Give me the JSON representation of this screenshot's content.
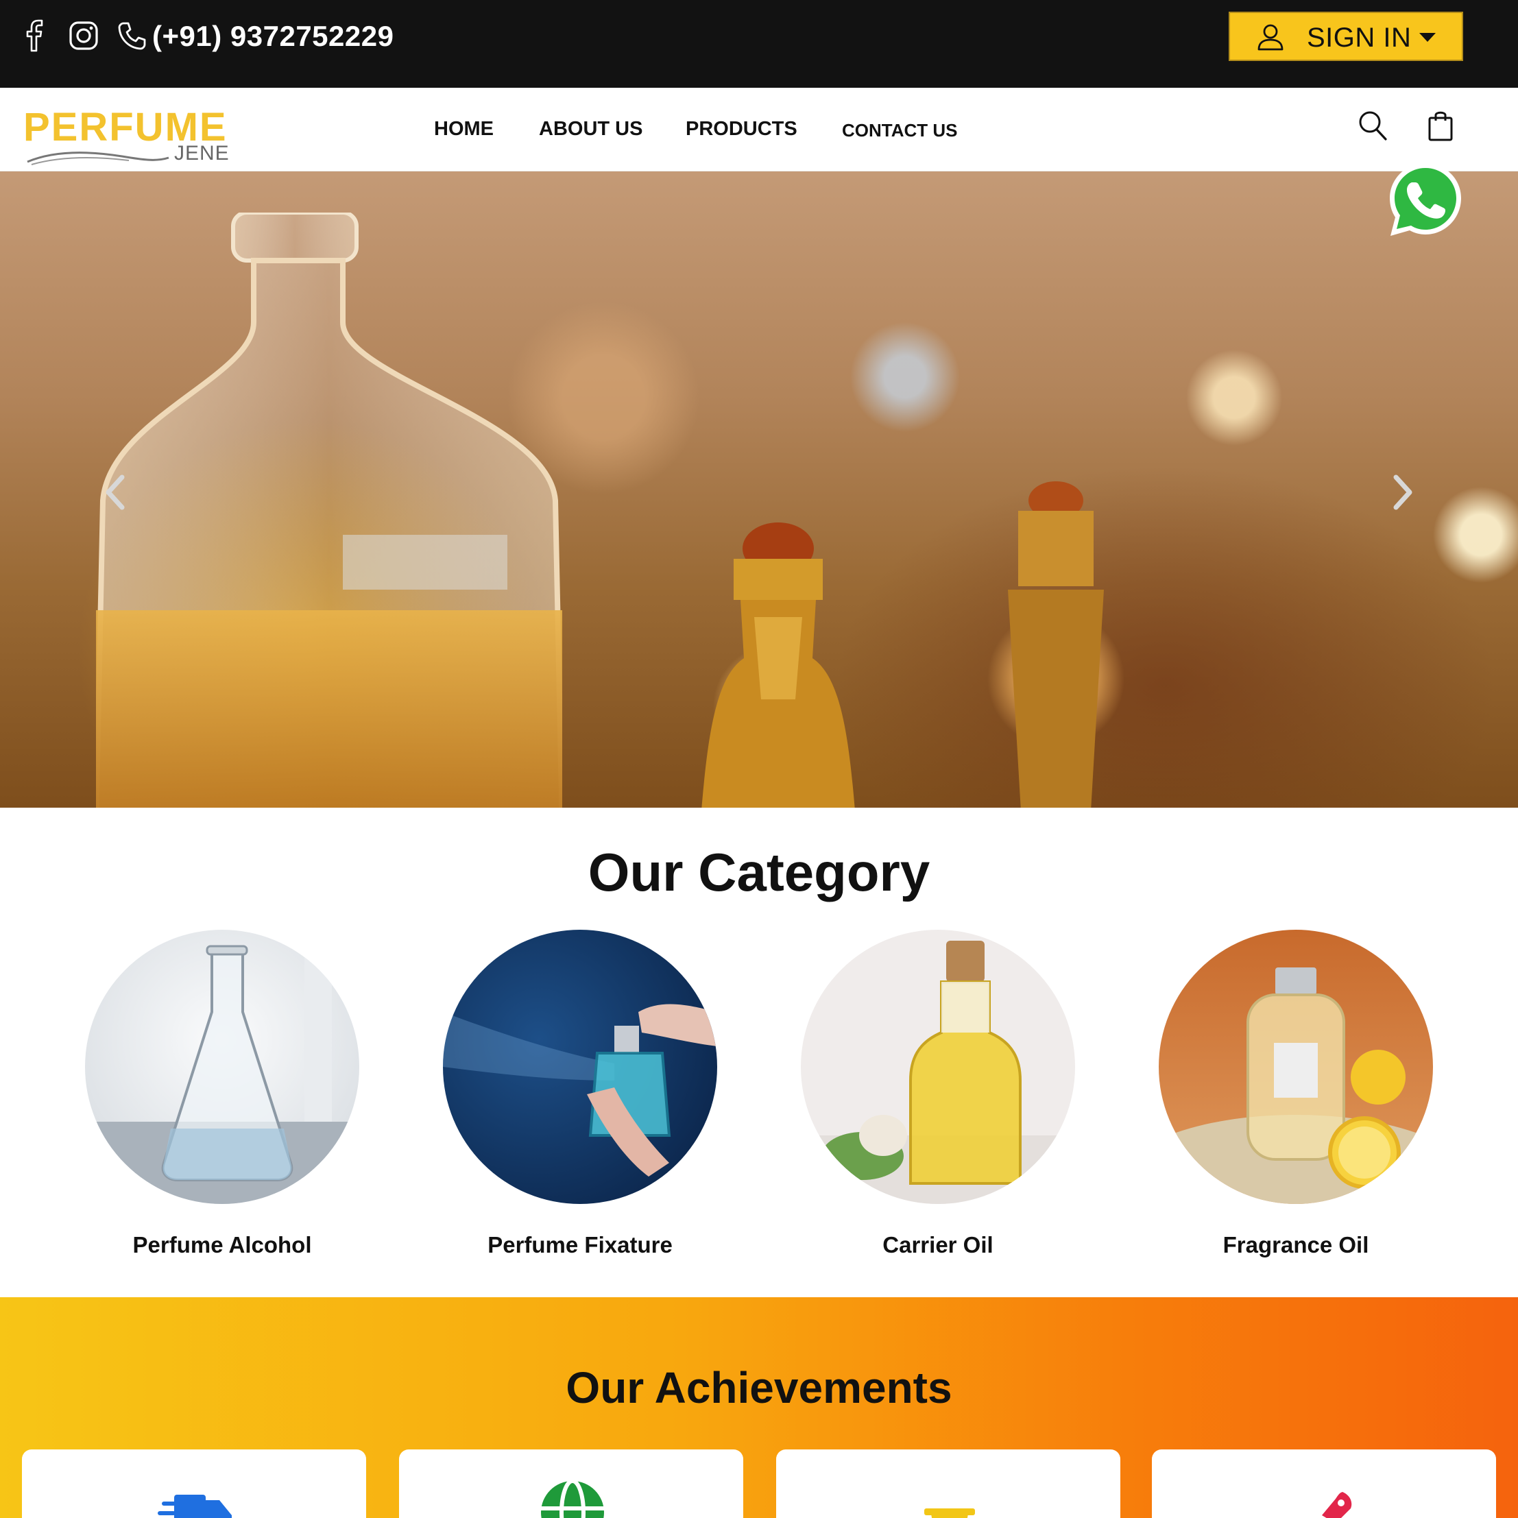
{
  "topbar": {
    "phone": "(+91) 9372752229",
    "signin_label": "SIGN IN",
    "icons": [
      "facebook-icon",
      "instagram-icon",
      "phone-icon",
      "user-icon",
      "caret-down-icon"
    ],
    "colors": {
      "background": "#121212",
      "signin_bg": "#f8c51c"
    }
  },
  "nav": {
    "logo_main": "PERFUME",
    "logo_sub": "JENE",
    "links": [
      "HOME",
      "ABOUT US",
      "PRODUCTS",
      "CONTACT US"
    ],
    "icons": [
      "search-icon",
      "shopping-bag-icon"
    ]
  },
  "hero": {
    "icons": [
      "arrow-left-icon",
      "arrow-right-icon",
      "whatsapp-icon"
    ]
  },
  "category": {
    "title": "Our Category",
    "items": [
      {
        "label": "Perfume Alcohol"
      },
      {
        "label": "Perfume Fixature"
      },
      {
        "label": "Carrier Oil"
      },
      {
        "label": "Fragrance Oil"
      }
    ]
  },
  "achievements": {
    "title": "Our Achievements",
    "icons": [
      "delivery-truck-icon",
      "globe-icon",
      "trophy-icon",
      "rocket-icon"
    ],
    "colors": {
      "gradient_start": "#f7c516",
      "gradient_end": "#f5630d"
    }
  }
}
